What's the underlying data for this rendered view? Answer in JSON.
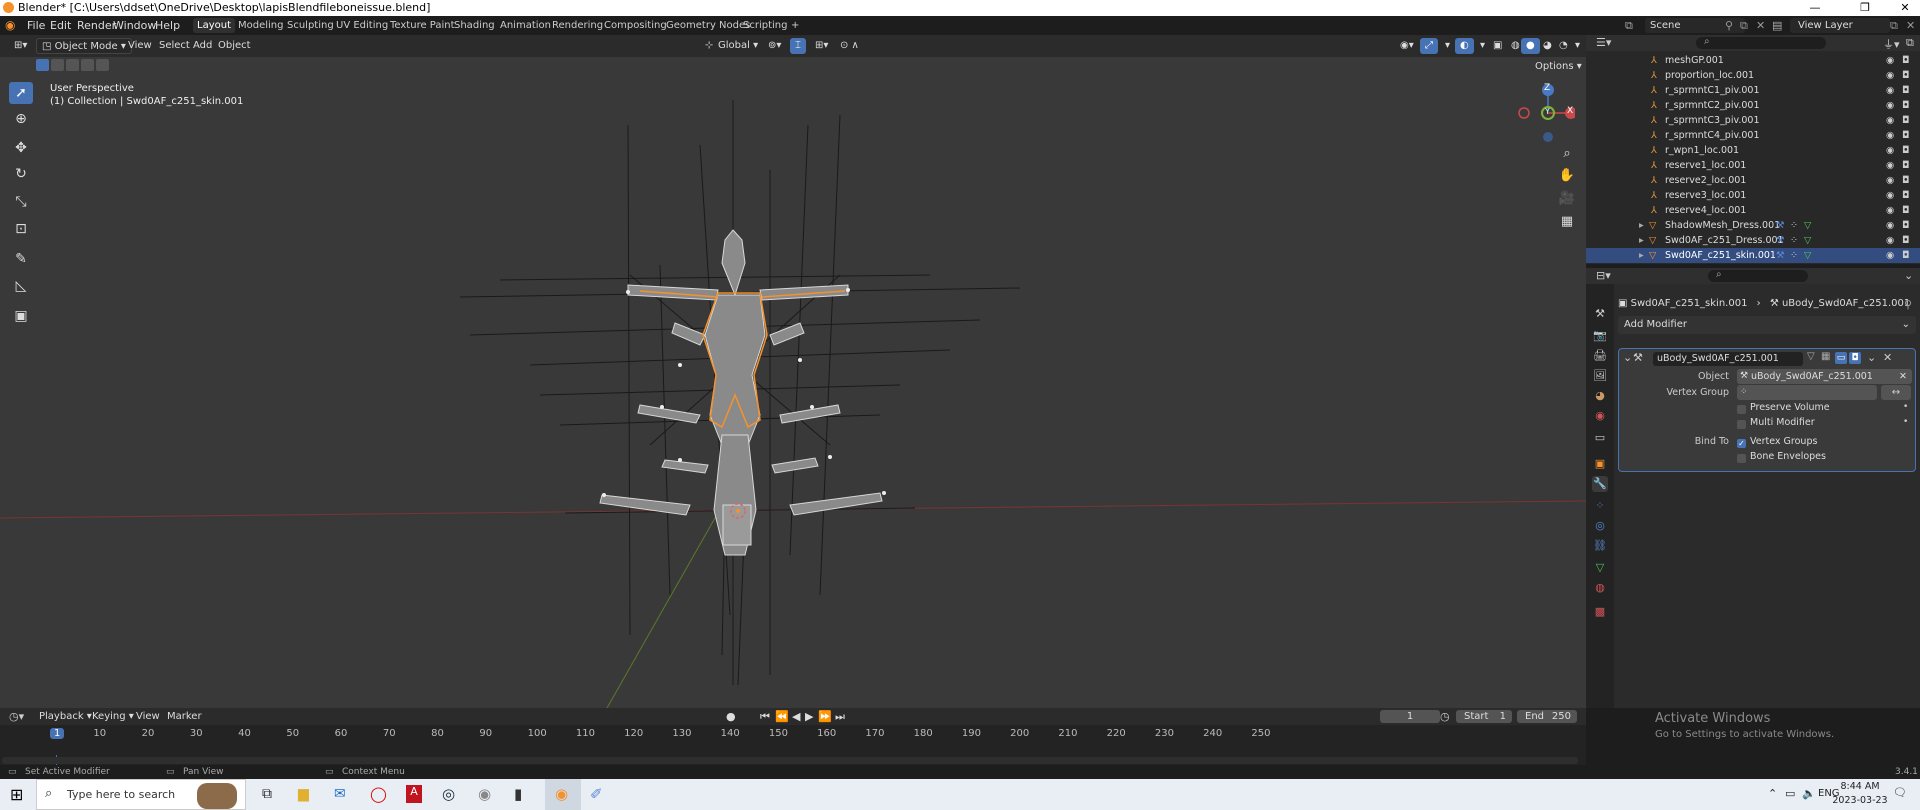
{
  "window": {
    "title": "Blender* [C:\\Users\\ddset\\OneDrive\\Desktop\\lapisBlendfileboneissue.blend]",
    "minimize": "—",
    "maximize": "❐",
    "close": "✕"
  },
  "menu": {
    "file": "File",
    "edit": "Edit",
    "render": "Render",
    "window": "Window",
    "help": "Help"
  },
  "workspaces": [
    "Layout",
    "Modeling",
    "Sculpting",
    "UV Editing",
    "Texture Paint",
    "Shading",
    "Animation",
    "Rendering",
    "Compositing",
    "Geometry Nodes",
    "Scripting",
    "+"
  ],
  "active_workspace": "Layout",
  "scene": {
    "label": "Scene",
    "viewlayer": "View Layer"
  },
  "viewport": {
    "mode": "Object Mode",
    "menus": [
      "View",
      "Select",
      "Add",
      "Object"
    ],
    "orientation": "Global",
    "options": "Options",
    "perspective": "User Perspective",
    "collection": "(1) Collection | Swd0AF_c251_skin.001",
    "axis_z": "Z",
    "axis_x": "X",
    "axis_y": "Y"
  },
  "outliner": {
    "items": [
      {
        "name": "meshGP.001",
        "type": "bone"
      },
      {
        "name": "proportion_loc.001",
        "type": "bone"
      },
      {
        "name": "r_sprmntC1_piv.001",
        "type": "bone"
      },
      {
        "name": "r_sprmntC2_piv.001",
        "type": "bone"
      },
      {
        "name": "r_sprmntC3_piv.001",
        "type": "bone"
      },
      {
        "name": "r_sprmntC4_piv.001",
        "type": "bone"
      },
      {
        "name": "r_wpn1_loc.001",
        "type": "bone"
      },
      {
        "name": "reserve1_loc.001",
        "type": "bone"
      },
      {
        "name": "reserve2_loc.001",
        "type": "bone"
      },
      {
        "name": "reserve3_loc.001",
        "type": "bone"
      },
      {
        "name": "reserve4_loc.001",
        "type": "bone"
      },
      {
        "name": "ShadowMesh_Dress.001",
        "type": "mesh"
      },
      {
        "name": "Swd0AF_c251_Dress.001",
        "type": "mesh"
      },
      {
        "name": "Swd0AF_c251_skin.001",
        "type": "mesh"
      }
    ],
    "selected_index": 13
  },
  "properties": {
    "breadcrumb_object": "Swd0AF_c251_skin.001",
    "breadcrumb_modifier": "uBody_Swd0AF_c251.001",
    "add_modifier": "Add Modifier",
    "modifier_name": "uBody_Swd0AF_c251.001",
    "object_label": "Object",
    "object_value": "uBody_Swd0AF_c251.001",
    "vertex_group_label": "Vertex Group",
    "preserve_volume": "Preserve Volume",
    "multi_modifier": "Multi Modifier",
    "bind_to_label": "Bind To",
    "vertex_groups": "Vertex Groups",
    "vertex_groups_checked": true,
    "bone_envelopes": "Bone Envelopes",
    "bone_envelopes_checked": false
  },
  "timeline": {
    "menus": [
      "Playback",
      "Keying",
      "View",
      "Marker"
    ],
    "current_frame": "1",
    "start_label": "Start",
    "start_value": "1",
    "end_label": "End",
    "end_value": "250",
    "ticks": [
      "1",
      "10",
      "20",
      "30",
      "40",
      "50",
      "60",
      "70",
      "80",
      "90",
      "100",
      "110",
      "120",
      "130",
      "140",
      "150",
      "160",
      "170",
      "180",
      "190",
      "200",
      "210",
      "220",
      "230",
      "240",
      "250"
    ]
  },
  "statusbar": {
    "left": "Set Active Modifier",
    "middle": "Pan View",
    "right": "Context Menu",
    "version": "3.4.1"
  },
  "watermark": {
    "title": "Activate Windows",
    "subtitle": "Go to Settings to activate Windows."
  },
  "taskbar": {
    "search_placeholder": "Type here to search",
    "language": "ENG",
    "time": "8:44 AM",
    "date": "2023-03-23"
  },
  "colors": {
    "accent": "#4772b3",
    "selected_row": "#334d80",
    "orange": "#f5922b",
    "bone": "#e89a3c",
    "mesh": "#e0a040"
  }
}
